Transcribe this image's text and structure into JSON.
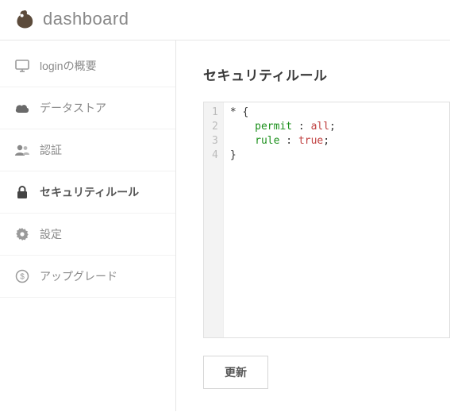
{
  "header": {
    "logo_text": "dashboard"
  },
  "sidebar": {
    "items": [
      {
        "icon": "monitor-icon",
        "label": "loginの概要"
      },
      {
        "icon": "cloud-icon",
        "label": "データストア"
      },
      {
        "icon": "user-icon",
        "label": "認証"
      },
      {
        "icon": "lock-icon",
        "label": "セキュリティルール"
      },
      {
        "icon": "gear-icon",
        "label": "設定"
      },
      {
        "icon": "dollar-icon",
        "label": "アップグレード"
      }
    ],
    "active_index": 3
  },
  "main": {
    "title": "セキュリティルール",
    "update_button_label": "更新"
  },
  "editor": {
    "lines": [
      {
        "n": "1",
        "tokens": [
          {
            "t": "* ",
            "c": "tok-sel"
          },
          {
            "t": "{",
            "c": "tok-punc"
          }
        ]
      },
      {
        "n": "2",
        "tokens": [
          {
            "t": "    ",
            "c": ""
          },
          {
            "t": "permit",
            "c": "tok-key"
          },
          {
            "t": " : ",
            "c": "tok-punc"
          },
          {
            "t": "all",
            "c": "tok-val"
          },
          {
            "t": ";",
            "c": "tok-punc"
          }
        ]
      },
      {
        "n": "3",
        "tokens": [
          {
            "t": "    ",
            "c": ""
          },
          {
            "t": "rule",
            "c": "tok-key"
          },
          {
            "t": " : ",
            "c": "tok-punc"
          },
          {
            "t": "true",
            "c": "tok-val"
          },
          {
            "t": ";",
            "c": "tok-punc"
          }
        ]
      },
      {
        "n": "4",
        "tokens": [
          {
            "t": "}",
            "c": "tok-punc"
          }
        ]
      }
    ]
  },
  "colors": {
    "icon_muted": "#9a9a9a",
    "icon_active": "#444"
  }
}
